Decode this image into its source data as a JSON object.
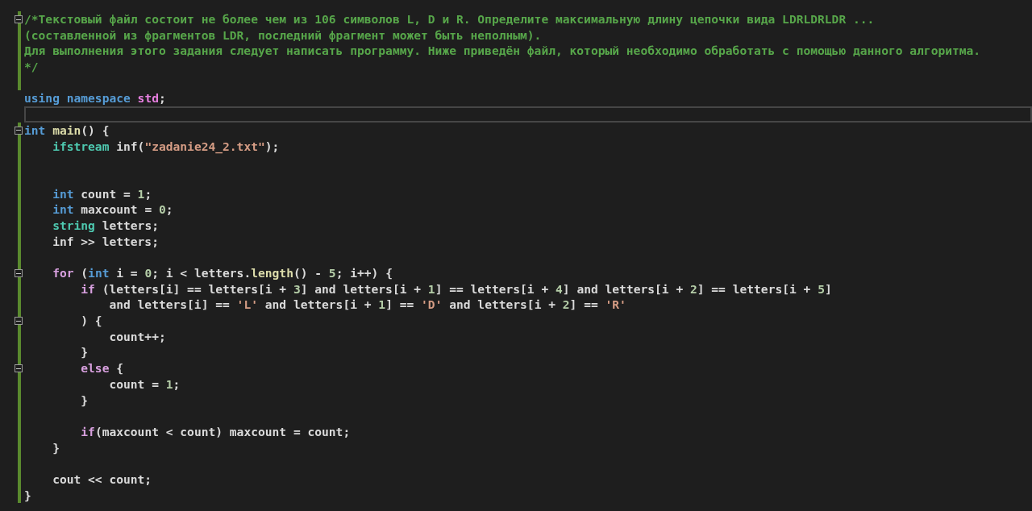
{
  "editor": {
    "lines": [
      {
        "changed": true,
        "fold": true,
        "current": false,
        "tokens": [
          {
            "kind": "comment",
            "text": "/*Текстовый файл состоит не более чем из 106 символов L, D и R. Определите максимальную длину цепочки вида LDRLDRLDR ..."
          }
        ]
      },
      {
        "changed": true,
        "fold": false,
        "current": false,
        "tokens": [
          {
            "kind": "comment",
            "text": "(составленной из фрагментов LDR, последний фрагмент может быть неполным)."
          }
        ]
      },
      {
        "changed": true,
        "fold": false,
        "current": false,
        "tokens": [
          {
            "kind": "comment",
            "text": "Для выполнения этого задания следует написать программу. Ниже приведён файл, который необходимо обработать с помощью данного алгоритма."
          }
        ]
      },
      {
        "changed": true,
        "fold": false,
        "current": false,
        "tokens": [
          {
            "kind": "comment",
            "text": "*/"
          }
        ]
      },
      {
        "changed": true,
        "fold": false,
        "current": false
      },
      {
        "changed": false,
        "fold": false,
        "current": false,
        "tokens": [
          {
            "kind": "keyword",
            "text": "using"
          },
          {
            "kind": "keyword",
            "text": " namespace"
          },
          {
            "kind": "namespace",
            "text": " std"
          },
          {
            "kind": "plain",
            "text": ";"
          }
        ]
      },
      {
        "changed": false,
        "fold": false,
        "current": true
      },
      {
        "changed": true,
        "fold": true,
        "current": false,
        "tokens": [
          {
            "kind": "keyword",
            "text": "int"
          },
          {
            "kind": "function",
            "text": " main"
          },
          {
            "kind": "plain",
            "text": "() {"
          }
        ]
      },
      {
        "changed": true,
        "fold": false,
        "current": false,
        "tokens": [
          {
            "kind": "type",
            "text": "    ifstream"
          },
          {
            "kind": "plain",
            "text": " inf("
          },
          {
            "kind": "string",
            "text": "\"zadanie24_2.txt\""
          },
          {
            "kind": "plain",
            "text": ");"
          }
        ]
      },
      {
        "changed": true,
        "fold": false,
        "current": false
      },
      {
        "changed": true,
        "fold": false,
        "current": false
      },
      {
        "changed": true,
        "fold": false,
        "current": false,
        "tokens": [
          {
            "kind": "keyword",
            "text": "    int"
          },
          {
            "kind": "plain",
            "text": " count = "
          },
          {
            "kind": "number",
            "text": "1"
          },
          {
            "kind": "plain",
            "text": ";"
          }
        ]
      },
      {
        "changed": true,
        "fold": false,
        "current": false,
        "tokens": [
          {
            "kind": "keyword",
            "text": "    int"
          },
          {
            "kind": "plain",
            "text": " maxcount = "
          },
          {
            "kind": "number",
            "text": "0"
          },
          {
            "kind": "plain",
            "text": ";"
          }
        ]
      },
      {
        "changed": true,
        "fold": false,
        "current": false,
        "tokens": [
          {
            "kind": "type",
            "text": "    string"
          },
          {
            "kind": "plain",
            "text": " letters;"
          }
        ]
      },
      {
        "changed": true,
        "fold": false,
        "current": false,
        "tokens": [
          {
            "kind": "plain",
            "text": "    inf >> letters;"
          }
        ]
      },
      {
        "changed": true,
        "fold": false,
        "current": false
      },
      {
        "changed": true,
        "fold": true,
        "current": false,
        "tokens": [
          {
            "kind": "control",
            "text": "    for"
          },
          {
            "kind": "plain",
            "text": " ("
          },
          {
            "kind": "keyword",
            "text": "int"
          },
          {
            "kind": "plain",
            "text": " i = "
          },
          {
            "kind": "number",
            "text": "0"
          },
          {
            "kind": "plain",
            "text": "; i < letters."
          },
          {
            "kind": "function",
            "text": "length"
          },
          {
            "kind": "plain",
            "text": "() - "
          },
          {
            "kind": "number",
            "text": "5"
          },
          {
            "kind": "plain",
            "text": "; i++) {"
          }
        ]
      },
      {
        "changed": true,
        "fold": false,
        "current": false,
        "tokens": [
          {
            "kind": "control",
            "text": "        if"
          },
          {
            "kind": "plain",
            "text": " (letters[i] == letters[i + "
          },
          {
            "kind": "number",
            "text": "3"
          },
          {
            "kind": "plain",
            "text": "] and letters[i + "
          },
          {
            "kind": "number",
            "text": "1"
          },
          {
            "kind": "plain",
            "text": "] == letters[i + "
          },
          {
            "kind": "number",
            "text": "4"
          },
          {
            "kind": "plain",
            "text": "] and letters[i + "
          },
          {
            "kind": "number",
            "text": "2"
          },
          {
            "kind": "plain",
            "text": "] == letters[i + "
          },
          {
            "kind": "number",
            "text": "5"
          },
          {
            "kind": "plain",
            "text": "]"
          }
        ]
      },
      {
        "changed": true,
        "fold": false,
        "current": false,
        "tokens": [
          {
            "kind": "plain",
            "text": "            and letters[i] == "
          },
          {
            "kind": "string",
            "text": "'L'"
          },
          {
            "kind": "plain",
            "text": " and letters[i + "
          },
          {
            "kind": "number",
            "text": "1"
          },
          {
            "kind": "plain",
            "text": "] == "
          },
          {
            "kind": "string",
            "text": "'D'"
          },
          {
            "kind": "plain",
            "text": " and letters[i + "
          },
          {
            "kind": "number",
            "text": "2"
          },
          {
            "kind": "plain",
            "text": "] == "
          },
          {
            "kind": "string",
            "text": "'R'"
          }
        ]
      },
      {
        "changed": true,
        "fold": true,
        "current": false,
        "tokens": [
          {
            "kind": "plain",
            "text": "        ) {"
          }
        ]
      },
      {
        "changed": true,
        "fold": false,
        "current": false,
        "tokens": [
          {
            "kind": "plain",
            "text": "            count++;"
          }
        ]
      },
      {
        "changed": true,
        "fold": false,
        "current": false,
        "tokens": [
          {
            "kind": "plain",
            "text": "        }"
          }
        ]
      },
      {
        "changed": true,
        "fold": true,
        "current": false,
        "tokens": [
          {
            "kind": "control",
            "text": "        else"
          },
          {
            "kind": "plain",
            "text": " {"
          }
        ]
      },
      {
        "changed": true,
        "fold": false,
        "current": false,
        "tokens": [
          {
            "kind": "plain",
            "text": "            count = "
          },
          {
            "kind": "number",
            "text": "1"
          },
          {
            "kind": "plain",
            "text": ";"
          }
        ]
      },
      {
        "changed": true,
        "fold": false,
        "current": false,
        "tokens": [
          {
            "kind": "plain",
            "text": "        }"
          }
        ]
      },
      {
        "changed": true,
        "fold": false,
        "current": false
      },
      {
        "changed": true,
        "fold": false,
        "current": false,
        "tokens": [
          {
            "kind": "control",
            "text": "        if"
          },
          {
            "kind": "plain",
            "text": "(maxcount < count) maxcount = count;"
          }
        ]
      },
      {
        "changed": true,
        "fold": false,
        "current": false,
        "tokens": [
          {
            "kind": "plain",
            "text": "    }"
          }
        ]
      },
      {
        "changed": true,
        "fold": false,
        "current": false
      },
      {
        "changed": true,
        "fold": false,
        "current": false,
        "tokens": [
          {
            "kind": "plain",
            "text": "    cout << count;"
          }
        ]
      },
      {
        "changed": true,
        "fold": false,
        "current": false,
        "tokens": [
          {
            "kind": "plain",
            "text": "}"
          }
        ]
      }
    ]
  }
}
